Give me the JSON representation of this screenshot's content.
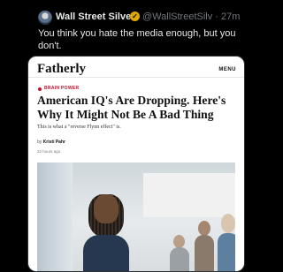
{
  "tweet": {
    "author_name": "Wall Street Silver",
    "handle_time": "@WallStreetSilv · 27m",
    "text": "You think you hate the media enough, but you don't."
  },
  "card": {
    "site_logo": "Fatherly",
    "menu_label": "MENU",
    "category": "BRAIN POWER",
    "headline": "American IQ's Are Dropping. Here's Why It Might Not Be A Bad Thing",
    "dek": "This is what a \"reverse Flynn effect\" is.",
    "byline_prefix": "by",
    "author": "Kristi Pahr",
    "time": "22 hours ago"
  },
  "icons": {
    "verified": "verified-badge-icon",
    "share": "share-icon"
  },
  "colors": {
    "background": "#000000",
    "text": "#e7e9ea",
    "muted": "#71767b",
    "badge": "#e0a800",
    "category": "#c8102e"
  }
}
